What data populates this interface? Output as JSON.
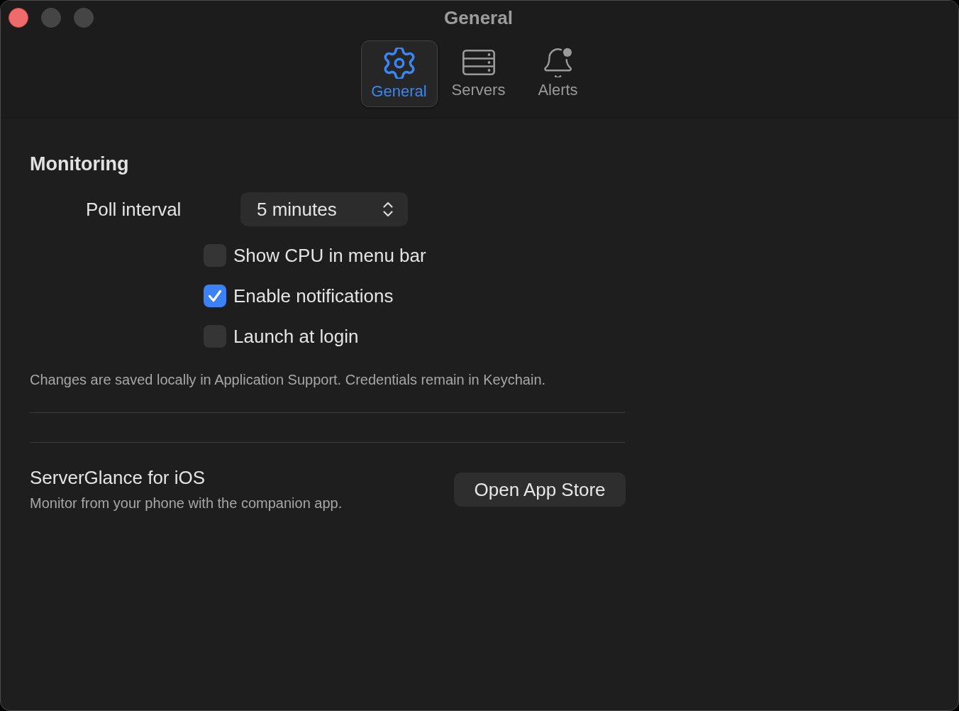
{
  "window": {
    "title": "General",
    "buttons": [
      {
        "kind": "close",
        "disabled": false
      },
      {
        "kind": "minimize",
        "disabled": true
      },
      {
        "kind": "zoom",
        "disabled": true
      }
    ]
  },
  "tabs": [
    {
      "kind": "gear",
      "label": "General",
      "selected": true
    },
    {
      "kind": "server",
      "label": "Servers",
      "selected": false
    },
    {
      "kind": "bell",
      "label": "Alerts",
      "selected": false
    }
  ],
  "monitoring": {
    "heading": "Monitoring",
    "poll_interval": {
      "label": "Poll interval",
      "value": "5 minutes"
    },
    "options": [
      {
        "label": "Show CPU in menu bar",
        "checked": false
      },
      {
        "label": "Enable notifications",
        "checked": true
      },
      {
        "label": "Launch at login",
        "checked": false
      }
    ],
    "note": "Changes are saved locally in Application Support. Credentials remain in Keychain."
  },
  "companion": {
    "title": "ServerGlance for iOS",
    "subtitle": "Monitor from your phone with the companion app.",
    "button": "Open App Store"
  }
}
